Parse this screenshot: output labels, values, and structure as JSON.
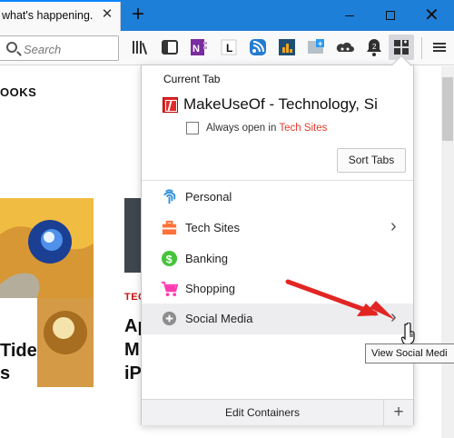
{
  "browser": {
    "tab_title": "what's happening.",
    "close_tab_icon": "close-icon",
    "new_tab_icon": "plus-icon",
    "search_placeholder": "Search",
    "window_controls": [
      "minimize-icon",
      "maximize-icon",
      "close-window-icon"
    ]
  },
  "toolbar": {
    "icons": [
      "library-icon",
      "sidebar-icon",
      "onenote-icon",
      "l-icon",
      "rss-icon",
      "analytics-icon",
      "screenshot-icon",
      "cloud-icon",
      "alert-icon",
      "containers-icon",
      "menu-icon"
    ],
    "alert_badge": "2"
  },
  "page": {
    "heading": "OOKS",
    "category": "TEC",
    "headline": "Ap M iP",
    "tide_lines": [
      "Tide",
      "s"
    ]
  },
  "containers_popup": {
    "current_tab_label": "Current Tab",
    "site_title": "MakeUseOf - Technology, Si",
    "always_open_prefix": "Always open in ",
    "always_open_target": "Tech Sites",
    "sort_tabs_label": "Sort Tabs",
    "items": [
      {
        "label": "Personal",
        "icon": "fingerprint-icon",
        "color": "#3291d8",
        "has_chevron": false
      },
      {
        "label": "Tech Sites",
        "icon": "briefcase-icon",
        "color": "#ff7137",
        "has_chevron": true
      },
      {
        "label": "Banking",
        "icon": "dollar-icon",
        "color": "#45c33b",
        "has_chevron": false
      },
      {
        "label": "Shopping",
        "icon": "cart-icon",
        "color": "#ff3bb0",
        "has_chevron": false
      },
      {
        "label": "Social Media",
        "icon": "circle-icon",
        "color": "#8e8e8e",
        "has_chevron": true
      }
    ],
    "edit_containers_label": "Edit Containers",
    "add_icon": "plus-icon"
  },
  "tooltip": "View Social Medi",
  "annotation": {
    "arrow_color": "#e22523"
  }
}
